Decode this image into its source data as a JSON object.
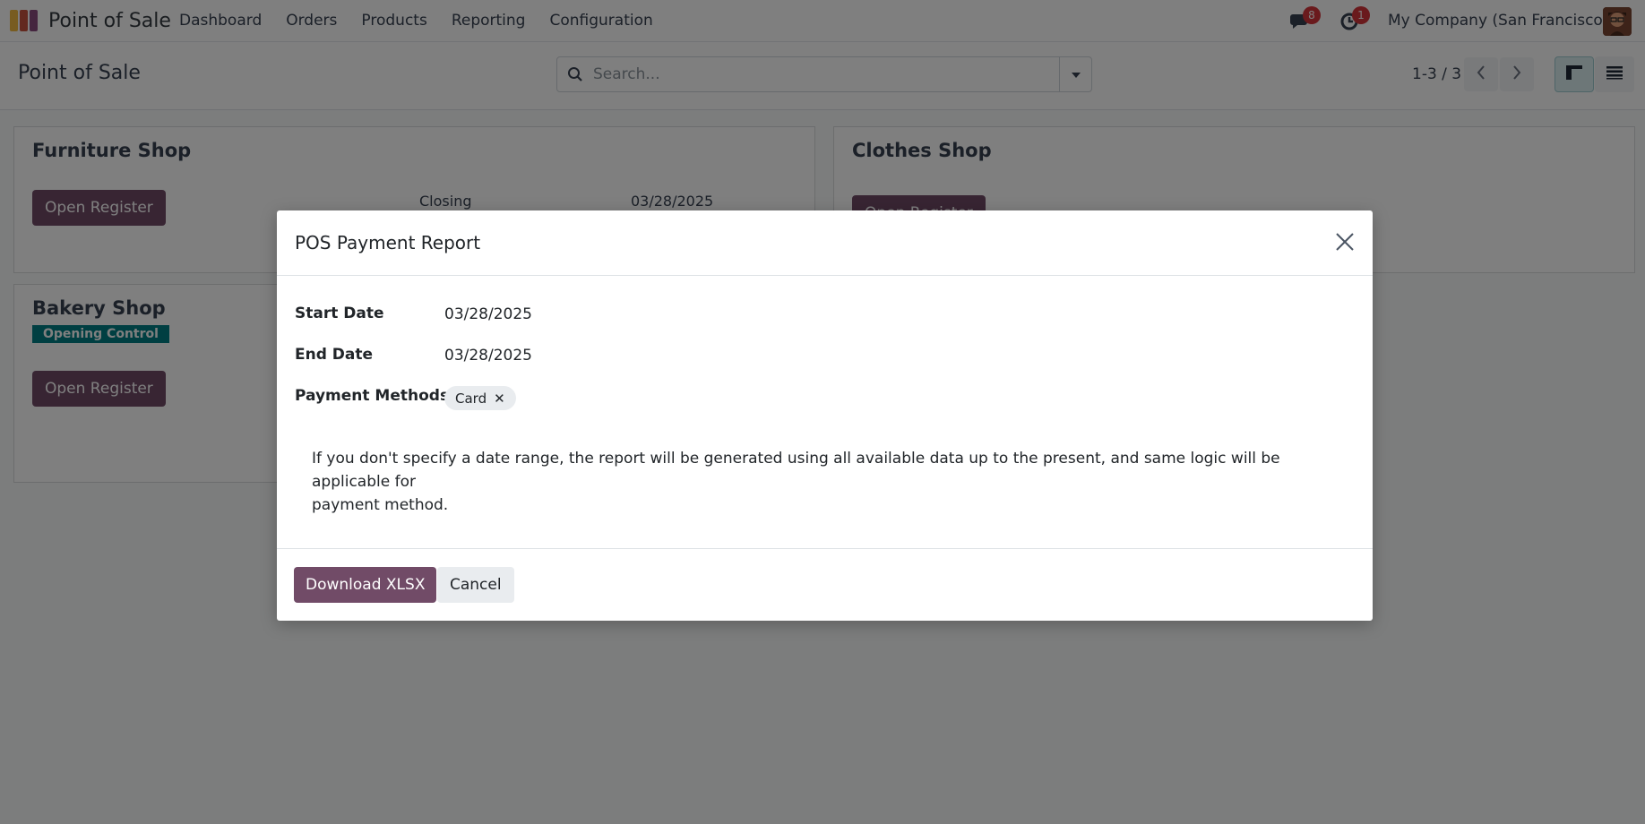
{
  "navbar": {
    "brand": "Point of Sale",
    "menu": [
      "Dashboard",
      "Orders",
      "Products",
      "Reporting",
      "Configuration"
    ],
    "messages_badge": "8",
    "activities_badge": "1",
    "company": "My Company (San Francisco)"
  },
  "control_panel": {
    "breadcrumb": "Point of Sale",
    "search_placeholder": "Search...",
    "pager": "1-3 / 3"
  },
  "cards": {
    "furniture": {
      "title": "Furniture Shop",
      "button": "Open Register",
      "closing_label": "Closing",
      "closing_date": "03/28/2025"
    },
    "clothes": {
      "title": "Clothes Shop",
      "button": "Open Register"
    },
    "bakery": {
      "title": "Bakery Shop",
      "status": "Opening Control",
      "button": "Open Register"
    }
  },
  "dialog": {
    "title": "POS Payment Report",
    "start_date_label": "Start Date",
    "start_date": "03/28/2025",
    "end_date_label": "End Date",
    "end_date": "03/28/2025",
    "payment_methods_label": "Payment Methods",
    "payment_method_tag": "Card",
    "notice_line1": "If you don't specify a date range, the report will be generated using all available data up to the present, and same logic will be applicable for",
    "notice_line2": "payment method.",
    "download_button": "Download XLSX",
    "cancel_button": "Cancel"
  },
  "colors": {
    "primary": "#714b67",
    "opening_tag": "#017e84",
    "badge": "#d4343a"
  }
}
